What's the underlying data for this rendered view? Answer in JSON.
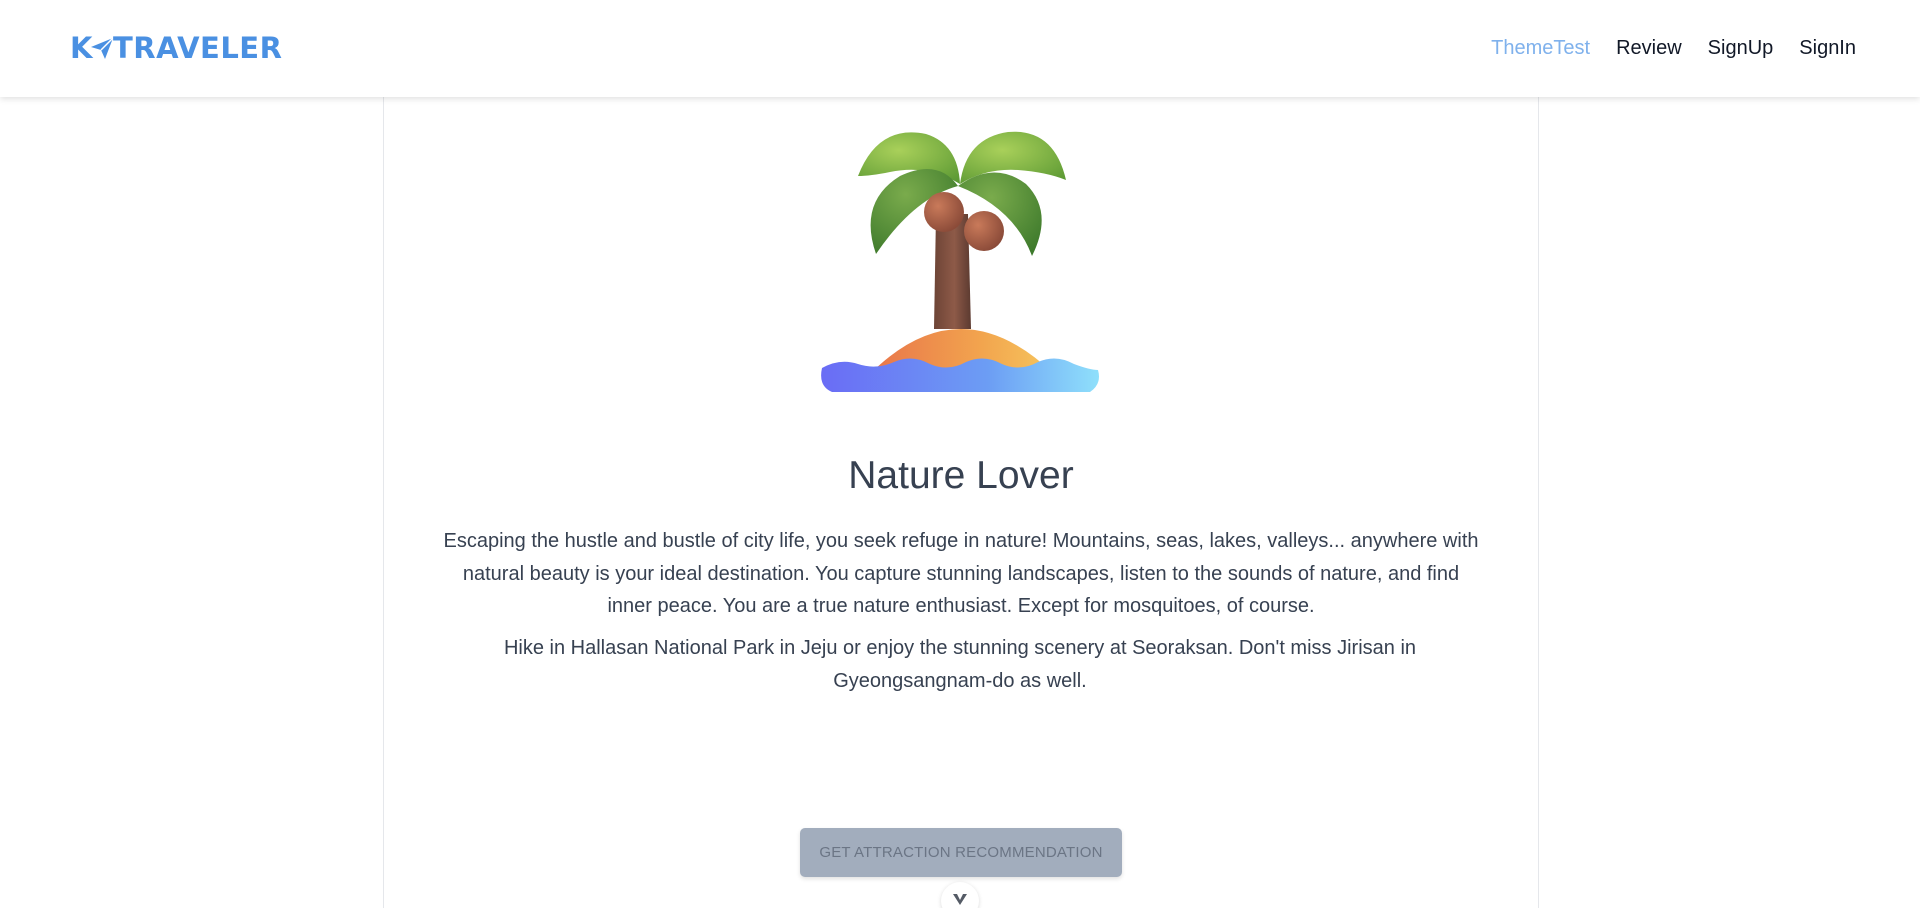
{
  "brand": {
    "logo_prefix": "K",
    "logo_suffix": "TRAVELER",
    "accent_color": "#4a90e2"
  },
  "nav": {
    "links": [
      {
        "label": "ThemeTest",
        "active": true
      },
      {
        "label": "Review",
        "active": false
      },
      {
        "label": "SignUp",
        "active": false
      },
      {
        "label": "SignIn",
        "active": false
      }
    ]
  },
  "result": {
    "illustration_icon": "palm-tree-island-icon",
    "title": "Nature Lover",
    "description": "Escaping the hustle and bustle of city life, you seek refuge in nature! Mountains, seas, lakes, valleys... anywhere with natural beauty is your ideal destination. You capture stunning landscapes, listen to the sounds of nature, and find inner peace. You are a true nature enthusiast. Except for mosquitoes, of course.",
    "recommendation": "Hike in Hallasan National Park in Jeju or enjoy the stunning scenery at Seoraksan. Don't miss Jirisan in Gyeongsangnam-do as well."
  },
  "actions": {
    "cta_label": "GET ATTRACTION RECOMMENDATION",
    "scroll_icon": "chevron-down-icon"
  }
}
